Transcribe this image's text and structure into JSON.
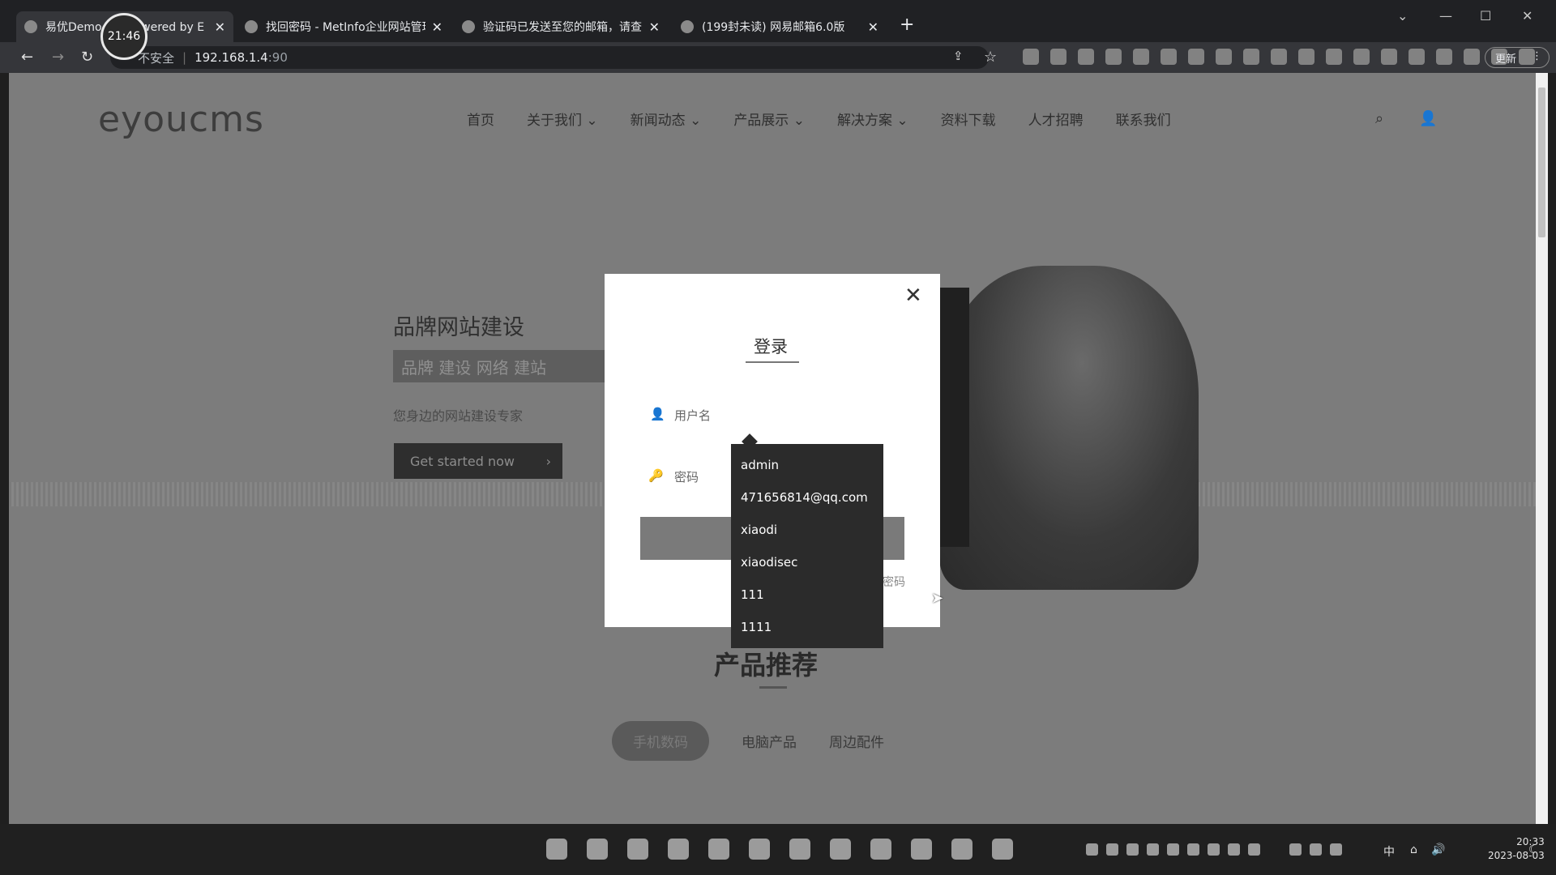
{
  "browser": {
    "tabs": [
      {
        "title": "易优Demo",
        "title_tail": "owered by E"
      },
      {
        "title": "找回密码 - MetInfo企业网站管理"
      },
      {
        "title": "验证码已发送至您的邮箱，请查"
      },
      {
        "title": "(199封未读) 网易邮箱6.0版"
      }
    ],
    "timer_badge": "21:46",
    "address": {
      "security_label": "不安全",
      "host": "192.168.1.4",
      "port": ":90"
    },
    "update_button": "更新"
  },
  "site": {
    "logo": "eyoucms",
    "nav": [
      "首页",
      "关于我们",
      "新闻动态",
      "产品展示",
      "解决方案",
      "资料下载",
      "人才招聘",
      "联系我们"
    ],
    "nav_dropdown_flags": [
      false,
      true,
      true,
      true,
      true,
      false,
      false,
      false
    ],
    "hero": {
      "title": "品牌网站建设",
      "highlight": "品牌 建设  网络 建站",
      "subtitle": "您身边的网站建设专家",
      "cta": "Get started now"
    },
    "products": {
      "title": "产品推荐",
      "tabs": [
        "手机数码",
        "电脑产品",
        "周边配件"
      ],
      "active_tab": 0
    }
  },
  "modal": {
    "title": "登录",
    "username_placeholder": "用户名",
    "password_placeholder": "密码",
    "forgot_fragment": "密码",
    "autocomplete": [
      "admin",
      "471656814@qq.com",
      "xiaodi",
      "xiaodisec",
      "111",
      "1111"
    ]
  },
  "taskbar": {
    "ime": "中",
    "time": "20:33",
    "date": "2023-08-03"
  }
}
